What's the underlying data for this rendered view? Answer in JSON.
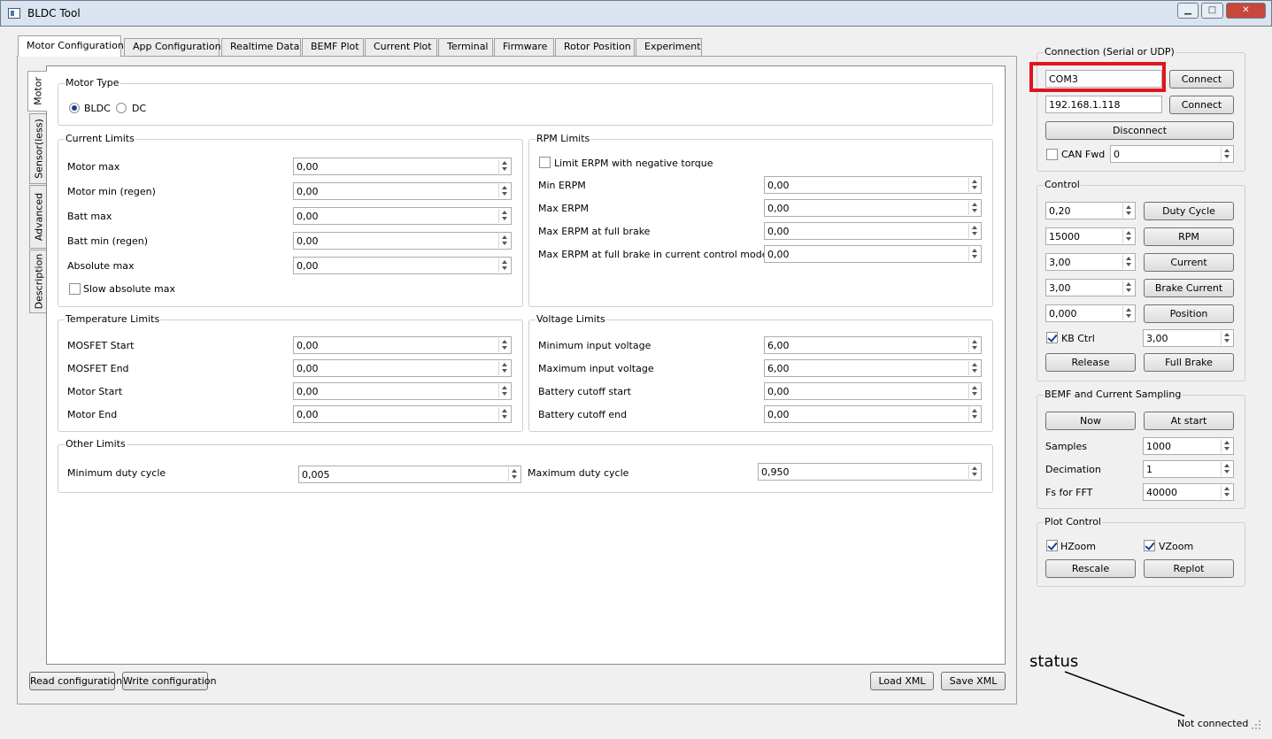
{
  "window": {
    "title": "BLDC Tool",
    "min": "▁",
    "max": "□",
    "close": "✕"
  },
  "tabs": [
    "Motor Configuration",
    "App Configuration",
    "Realtime Data",
    "BEMF Plot",
    "Current Plot",
    "Terminal",
    "Firmware",
    "Rotor Position",
    "Experiment"
  ],
  "vtabs": [
    "Motor",
    "Sensor(less)",
    "Advanced",
    "Description"
  ],
  "motor_type": {
    "title": "Motor Type",
    "bldc": "BLDC",
    "dc": "DC"
  },
  "current_limits": {
    "title": "Current Limits",
    "rows": [
      {
        "label": "Motor max",
        "value": "0,00"
      },
      {
        "label": "Motor min (regen)",
        "value": "0,00"
      },
      {
        "label": "Batt max",
        "value": "0,00"
      },
      {
        "label": "Batt min (regen)",
        "value": "0,00"
      },
      {
        "label": "Absolute max",
        "value": "0,00"
      }
    ],
    "slow_abs": "Slow absolute max"
  },
  "rpm_limits": {
    "title": "RPM Limits",
    "limit_neg": "Limit ERPM with negative torque",
    "rows": [
      {
        "label": "Min ERPM",
        "value": "0,00"
      },
      {
        "label": "Max ERPM",
        "value": "0,00"
      },
      {
        "label": "Max ERPM at full brake",
        "value": "0,00"
      },
      {
        "label": "Max ERPM at full brake in current control mode",
        "value": "0,00"
      }
    ]
  },
  "temp_limits": {
    "title": "Temperature Limits",
    "rows": [
      {
        "label": "MOSFET Start",
        "value": "0,00"
      },
      {
        "label": "MOSFET End",
        "value": "0,00"
      },
      {
        "label": "Motor Start",
        "value": "0,00"
      },
      {
        "label": "Motor End",
        "value": "0,00"
      }
    ]
  },
  "voltage_limits": {
    "title": "Voltage Limits",
    "rows": [
      {
        "label": "Minimum input voltage",
        "value": "6,00"
      },
      {
        "label": "Maximum input voltage",
        "value": "6,00"
      },
      {
        "label": "Battery cutoff start",
        "value": "0,00"
      },
      {
        "label": "Battery cutoff end",
        "value": "0,00"
      }
    ]
  },
  "other_limits": {
    "title": "Other Limits",
    "min_duty_label": "Minimum duty cycle",
    "min_duty": "0,005",
    "max_duty_label": "Maximum duty cycle",
    "max_duty": "0,950"
  },
  "bottom": {
    "read": "Read configuration",
    "write": "Write configuration",
    "load": "Load XML",
    "save": "Save XML"
  },
  "connection": {
    "title": "Connection (Serial or UDP)",
    "serial": "COM3",
    "udp": "192.168.1.118",
    "connect": "Connect",
    "disconnect": "Disconnect",
    "can_fwd": "CAN Fwd",
    "can_id": "0"
  },
  "control": {
    "title": "Control",
    "rows": [
      {
        "value": "0,20",
        "button": "Duty Cycle"
      },
      {
        "value": "15000",
        "button": "RPM"
      },
      {
        "value": "3,00",
        "button": "Current"
      },
      {
        "value": "3,00",
        "button": "Brake Current"
      },
      {
        "value": "0,000",
        "button": "Position"
      }
    ],
    "kb_ctrl": "KB Ctrl",
    "kb_value": "3,00",
    "release": "Release",
    "full_brake": "Full Brake"
  },
  "bemf": {
    "title": "BEMF and Current Sampling",
    "now": "Now",
    "at_start": "At start",
    "rows": [
      {
        "label": "Samples",
        "value": "1000"
      },
      {
        "label": "Decimation",
        "value": "1"
      },
      {
        "label": "Fs for FFT",
        "value": "40000"
      }
    ]
  },
  "plot_control": {
    "title": "Plot Control",
    "hzoom": "HZoom",
    "vzoom": "VZoom",
    "rescale": "Rescale",
    "replot": "Replot"
  },
  "annotation": "status",
  "status": "Not connected",
  "colors": {
    "highlight": "#e0141e"
  }
}
